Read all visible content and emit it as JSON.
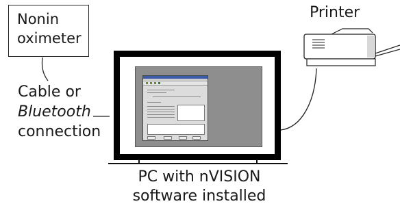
{
  "oximeter": {
    "line1": "Nonin",
    "line2": "oximeter"
  },
  "connection": {
    "line1": "Cable or",
    "line2": "Bluetooth",
    "line3": "connection"
  },
  "printer": {
    "label": "Printer"
  },
  "pc": {
    "line1": "PC with nVISION",
    "line2": "software installed"
  },
  "icons": {
    "printer": "printer-icon",
    "monitor": "monitor-icon"
  },
  "colors": {
    "monitor_frame": "#000000",
    "screen_background": "#8e8e8e",
    "window_titlebar": "#3b5ca8"
  }
}
